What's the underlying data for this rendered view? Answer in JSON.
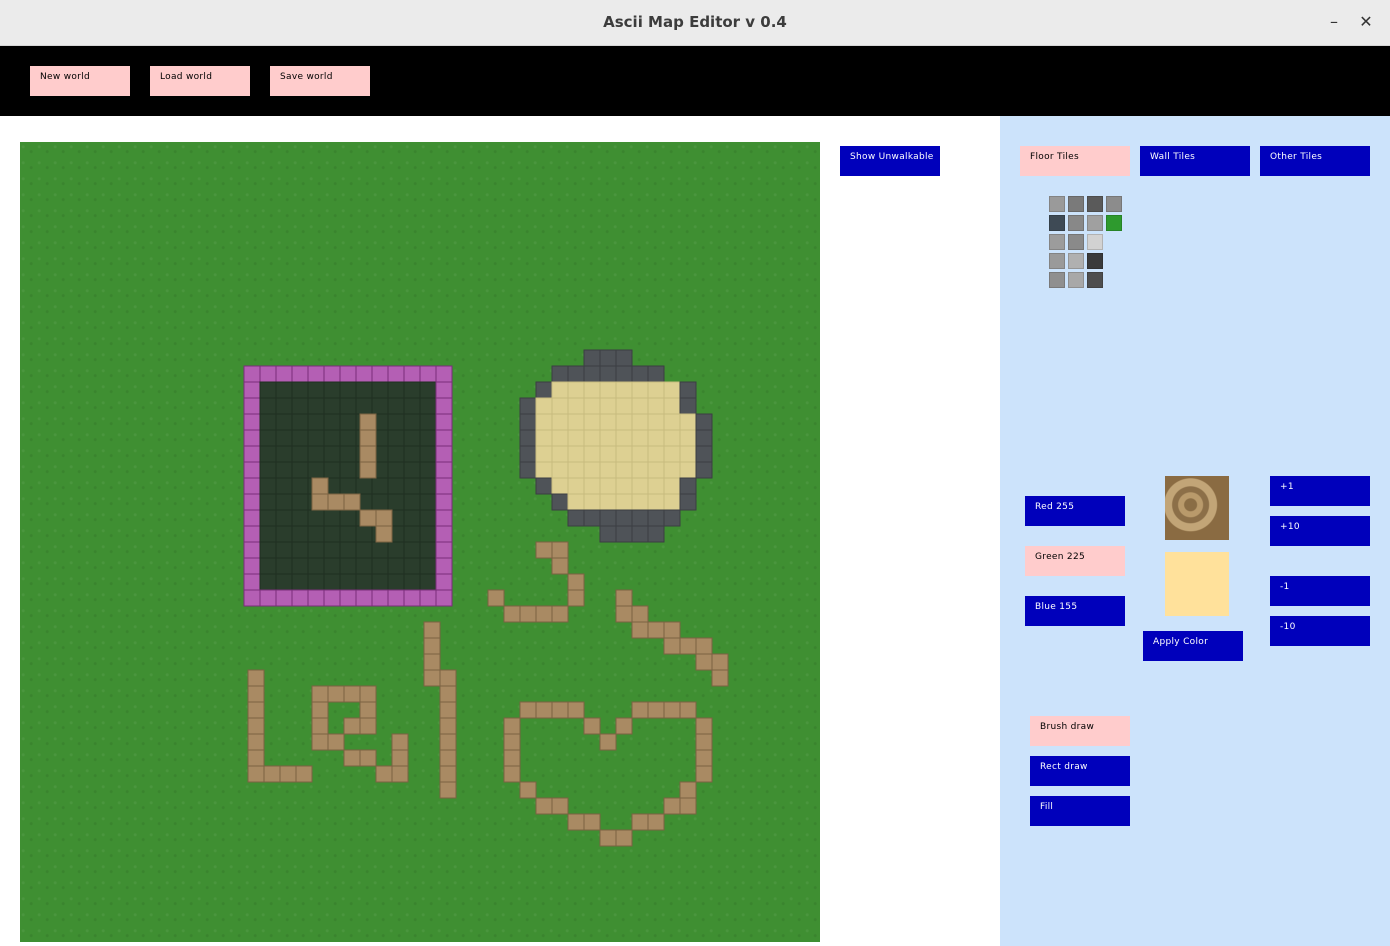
{
  "window": {
    "title": "Ascii Map Editor v 0.4",
    "minimize_glyph": "–",
    "close_glyph": "✕"
  },
  "toolbar": {
    "new_world": "New world",
    "load_world": "Load world",
    "save_world": "Save world"
  },
  "map": {
    "show_unwalkable": "Show Unwalkable"
  },
  "tile_panel": {
    "tabs": [
      "Floor Tiles",
      "Wall Tiles",
      "Other Tiles"
    ],
    "active_tab": "Floor Tiles",
    "palette_colors": [
      [
        "#9a9a9a",
        "#7a7a7a",
        "#5a5a5a",
        "#8c8c8c"
      ],
      [
        "#3e4a55",
        "#888888",
        "#a0a0a0",
        "#2e9a2e"
      ],
      [
        "#9c9c9c",
        "#8a8a8a",
        "#d2d2d2",
        ""
      ],
      [
        "#9a9a9a",
        "#b0b0b0",
        "#3a3a3a",
        ""
      ],
      [
        "#8f8f8f",
        "#a8a8a8",
        "#4e4e4e",
        ""
      ]
    ]
  },
  "color_panel": {
    "red_label": "Red 255",
    "green_label": "Green 225",
    "blue_label": "Blue 155",
    "selected_color": "#ffe19b",
    "apply_label": "Apply Color",
    "plus1": "+1",
    "plus10": "+10",
    "minus1": "-1",
    "minus10": "-10"
  },
  "draw_modes": {
    "brush": "Brush draw",
    "rect": "Rect draw",
    "fill": "Fill",
    "active": "Brush draw"
  },
  "colors": {
    "grass": "#3f8f32",
    "path": "#a98a63",
    "wall_purple": "#b45fb4",
    "dark_floor": "#2a3d2c",
    "stone": "#4f5358",
    "sand": "#ddd092",
    "button_blue": "#0000bb",
    "button_pink": "#ffcccc",
    "panel_bg": "#cce3fb"
  }
}
